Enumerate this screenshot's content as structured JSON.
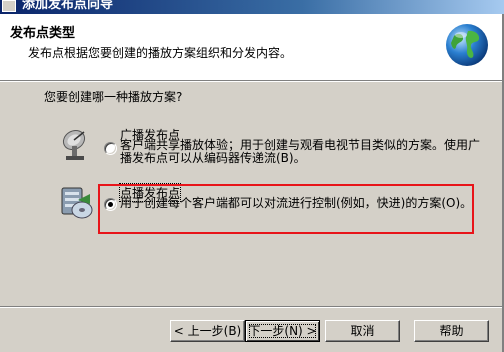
{
  "window": {
    "title": "添加发布点向导"
  },
  "header": {
    "title": "发布点类型",
    "subtitle": "发布点根据您要创建的播放方案组织和分发内容。"
  },
  "body": {
    "question": "您要创建哪一种播放方案?",
    "options": [
      {
        "label": "广播发布点",
        "description": "客户端共享播放体验；用于创建与观看电视节目类似的方案。使用广播发布点可以从编码器传递流(B)。",
        "selected": false,
        "icon": "satellite-dish-icon"
      },
      {
        "label": "点播发布点",
        "description": "用于创建每个客户端都可以对流进行控制(例如，快进)的方案(O)。",
        "selected": true,
        "icon": "server-disk-icon"
      }
    ]
  },
  "buttons": {
    "back": "< 上一步(B)",
    "next": "下一步(N) >",
    "cancel": "取消",
    "help": "帮助"
  },
  "colors": {
    "highlight_box": "#e8141a",
    "title_bar": "#0a246a",
    "dialog_bg": "#d4d0c8"
  }
}
